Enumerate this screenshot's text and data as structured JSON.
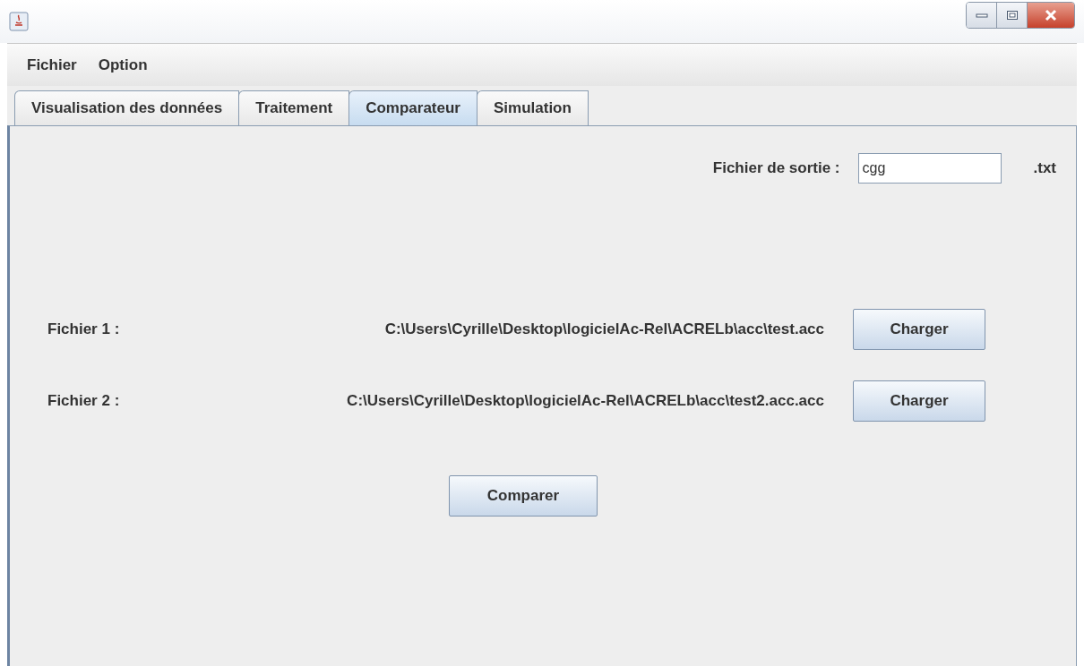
{
  "menu": [
    "Fichier",
    "Option"
  ],
  "tabs": [
    {
      "label": "Visualisation des données",
      "selected": false
    },
    {
      "label": "Traitement",
      "selected": false
    },
    {
      "label": "Comparateur",
      "selected": true
    },
    {
      "label": "Simulation",
      "selected": false
    }
  ],
  "output": {
    "label": "Fichier de sortie :",
    "value": "cgg",
    "suffix": ".txt"
  },
  "files": [
    {
      "label": "Fichier 1 :",
      "path": "C:\\Users\\Cyrille\\Desktop\\logicielAc-Rel\\ACRELb\\acc\\test.acc",
      "button": "Charger"
    },
    {
      "label": "Fichier 2 :",
      "path": "C:\\Users\\Cyrille\\Desktop\\logicielAc-Rel\\ACRELb\\acc\\test2.acc.acc",
      "button": "Charger"
    }
  ],
  "compare_button": "Comparer"
}
